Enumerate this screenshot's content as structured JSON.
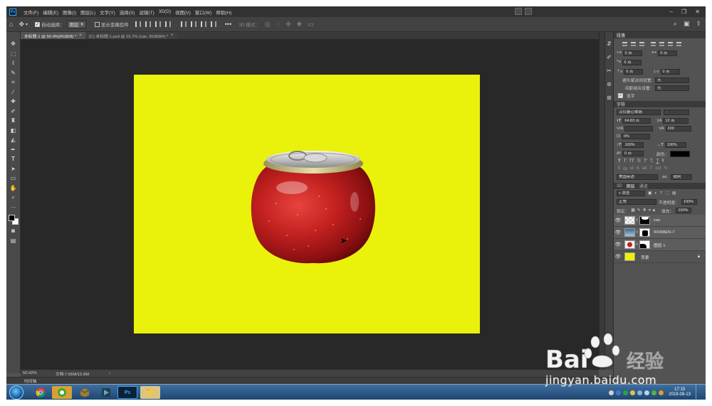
{
  "app": {
    "logo": "Ps"
  },
  "menu": [
    "文件(F)",
    "编辑(E)",
    "图像(I)",
    "图层(L)",
    "文字(Y)",
    "选择(S)",
    "滤镜(T)",
    "3D(D)",
    "视图(V)",
    "窗口(W)",
    "帮助(H)"
  ],
  "options_bar": {
    "auto_select_label": "自动选择：",
    "auto_select_value": "图层",
    "transform_label": "显示变换控件",
    "mode_3d": "3D 模式："
  },
  "tabs": [
    {
      "label": "未标题-1 @ 50.4%(RGB/8) *",
      "active": true
    },
    {
      "label": "(C) 未标题-1.psd @ 16.7% (can, RGB/8#) *",
      "active": false
    }
  ],
  "status_bar": {
    "zoom": "50.42%",
    "doc_size": "文档:7.66M/15.6M"
  },
  "timeline_label": "时间轴",
  "paragraph_panel": {
    "title": "段落",
    "indent_left": "0 点",
    "indent_right": "0 点",
    "first_line": "0 点",
    "space_before": "0 点",
    "space_after": "0 点",
    "kinsoku_label": "避头尾法则设置：",
    "kinsoku_value": "无",
    "mojikumi_label": "间距组合设置：",
    "mojikumi_value": "无",
    "hyphenate_label": "连字"
  },
  "character_panel": {
    "title": "字符",
    "font_family": "汉仪菱心体简",
    "font_style": "-",
    "font_size": "64.83 点",
    "leading": "12 点",
    "kerning": "V/A",
    "tracking": "200",
    "vscale_label": "0%",
    "vert_scale": "100%",
    "horiz_scale": "100%",
    "baseline": "0 点",
    "color_label": "颜色：",
    "type_styles": [
      "T",
      "T",
      "TT",
      "Tr",
      "T'",
      "T,",
      "T",
      "Ŧ"
    ],
    "ot_styles": [
      "fi",
      "ꝏ",
      "st",
      "A",
      "ad",
      "T",
      "1st",
      "½"
    ],
    "language": "美国英语",
    "antialias_icon": "aa",
    "antialias": "锐利"
  },
  "layers_panel": {
    "tabs": [
      "3D",
      "图层",
      "通道"
    ],
    "filter": "类型",
    "blend_mode": "正常",
    "opacity_label": "不透明度：",
    "opacity": "100%",
    "lock_label": "锁定：",
    "fill_label": "填充：",
    "fill": "100%",
    "layers": [
      {
        "name": "can"
      },
      {
        "name": "00058EN-7"
      },
      {
        "name": "图层 1"
      },
      {
        "name": "背景"
      }
    ]
  },
  "taskbar": {
    "time": "17:15",
    "date": "2019-08-13"
  },
  "watermark": {
    "url_text": "jingyan.baidu.com"
  },
  "colors": {
    "canvas_yellow": "#eaf10a",
    "accent_blue": "#31a8ff",
    "ui_dark": "#535353"
  }
}
